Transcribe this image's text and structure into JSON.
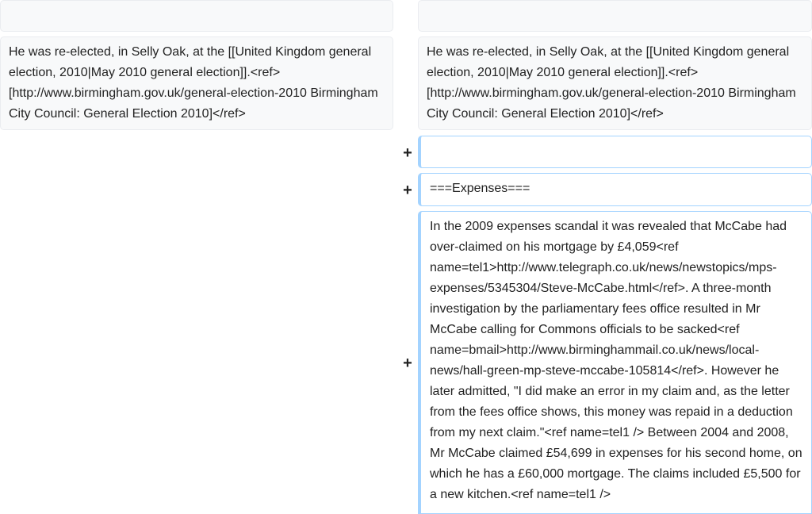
{
  "diff": {
    "left": {
      "empty_context": "",
      "context_text": "He was re-elected, in Selly Oak, at the [[United Kingdom general election, 2010|May 2010 general election]].<ref>[http://www.birmingham.gov.uk/general-election-2010 Birmingham City Council: General Election 2010]</ref>"
    },
    "right": {
      "empty_context": "",
      "context_text": "He was re-elected, in Selly Oak, at the [[United Kingdom general election, 2010|May 2010 general election]].<ref>[http://www.birmingham.gov.uk/general-election-2010 Birmingham City Council: General Election 2010]</ref>",
      "added_lines": [
        {
          "marker": "+",
          "text": ""
        },
        {
          "marker": "+",
          "text": "===Expenses==="
        },
        {
          "marker": "+",
          "text": "In the 2009 expenses scandal it was revealed that McCabe had over-claimed on his mortgage by £4,059<ref name=tel1>http://www.telegraph.co.uk/news/newstopics/mps-expenses/5345304/Steve-McCabe.html</ref>. A three-month investigation by the parliamentary fees office resulted in Mr McCabe calling for Commons officials to be sacked<ref name=bmail>http://www.birminghammail.co.uk/news/local-news/hall-green-mp-steve-mccabe-105814</ref>. However he later admitted, \"I did make an error in my claim and, as the letter from the fees office shows, this money was repaid in a deduction from my next claim.\"<ref name=tel1 /> Between 2004 and 2008, Mr McCabe claimed £54,699 in expenses for his second home, on which he has a £60,000 mortgage. The claims included £5,500 for a new kitchen.<ref name=tel1 />"
        }
      ]
    }
  }
}
